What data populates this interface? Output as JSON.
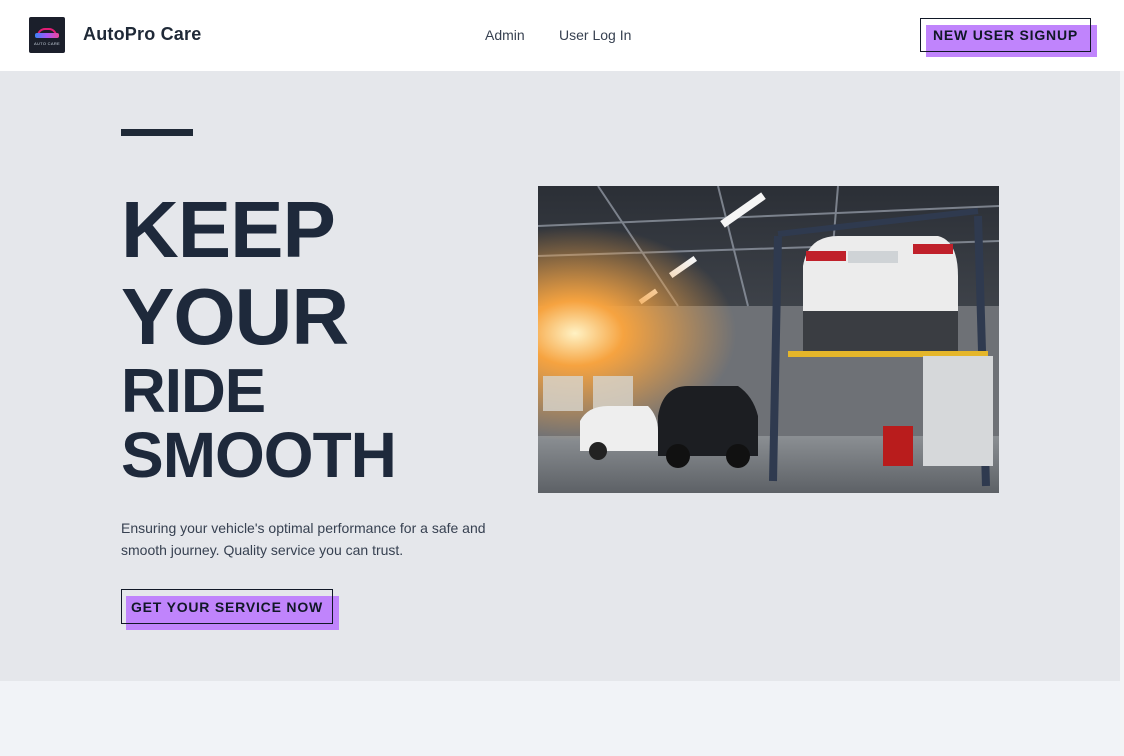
{
  "header": {
    "logo_text": "AUTO CARE",
    "brand": "AutoPro Care",
    "nav": [
      {
        "label": "Admin"
      },
      {
        "label": "User Log In"
      }
    ],
    "signup_label": "NEW USER SIGNUP"
  },
  "hero": {
    "headline": [
      "KEEP",
      "YOUR",
      "RIDE",
      "SMOOTH"
    ],
    "description": "Ensuring your vehicle's optimal performance for a safe and smooth journey. Quality service you can trust.",
    "cta_label": "GET YOUR SERVICE NOW",
    "image_icon": "garage-lift-photo"
  },
  "colors": {
    "accent": "#c084fc",
    "hero_bg": "#e5e7eb",
    "heading": "#1e293b"
  }
}
